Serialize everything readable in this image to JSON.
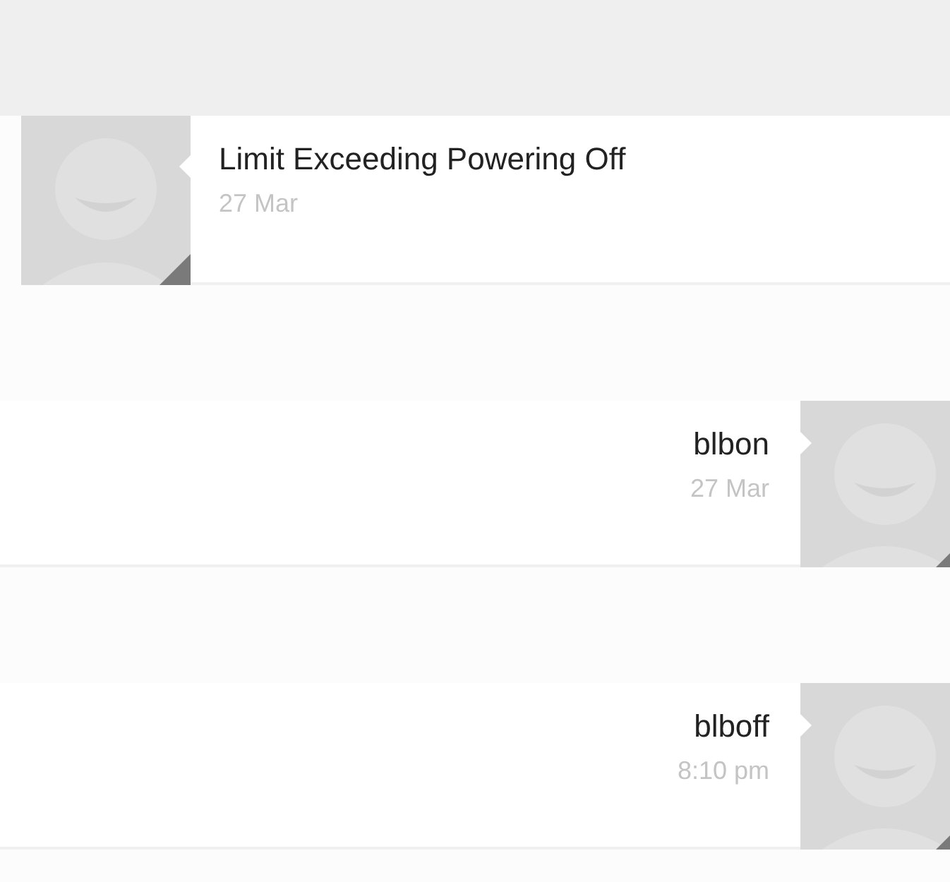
{
  "messages": [
    {
      "kind": "incoming",
      "text": "Limit Exceeding Powering Off",
      "time": "27 Mar"
    },
    {
      "kind": "outgoing",
      "text": "blbon",
      "time": "27 Mar"
    },
    {
      "kind": "outgoing",
      "text": "blboff",
      "time": "8:10 pm"
    }
  ]
}
